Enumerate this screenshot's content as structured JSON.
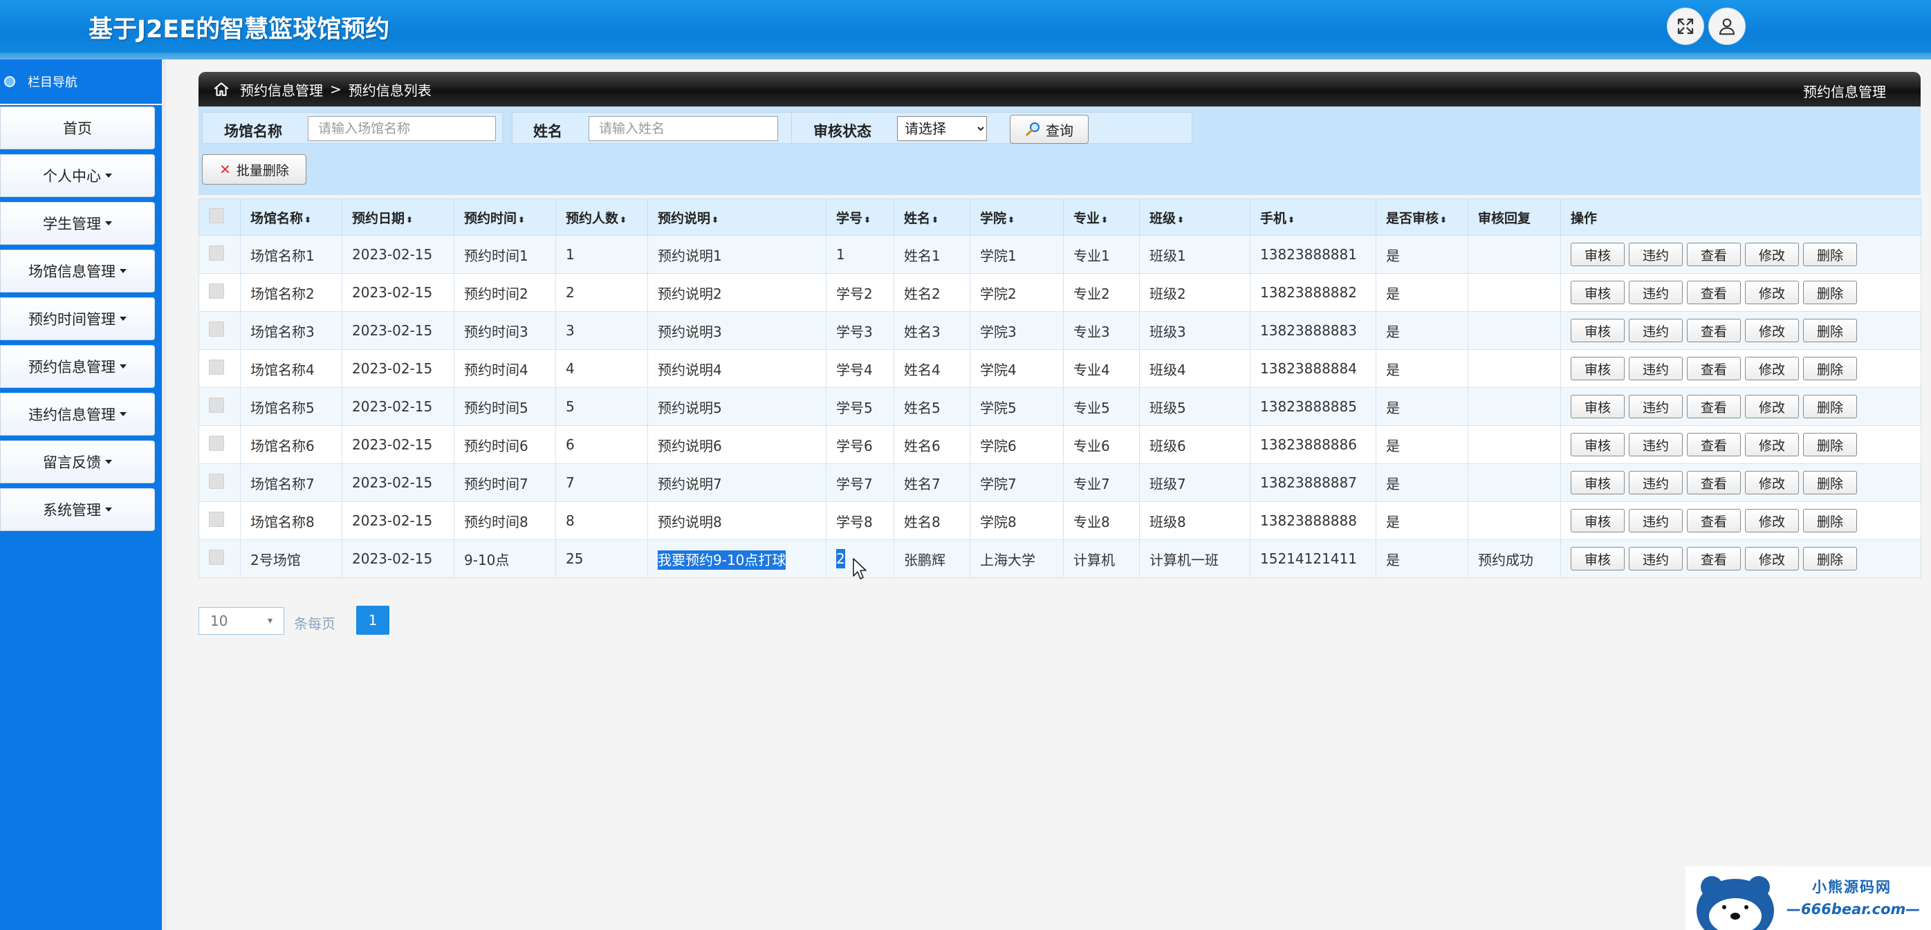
{
  "header": {
    "title": "基于J2EE的智慧篮球馆预约"
  },
  "sidebar": {
    "nav_title": "栏目导航",
    "items": [
      {
        "label": "首页",
        "has_caret": false
      },
      {
        "label": "个人中心",
        "has_caret": true
      },
      {
        "label": "学生管理",
        "has_caret": true
      },
      {
        "label": "场馆信息管理",
        "has_caret": true
      },
      {
        "label": "预约时间管理",
        "has_caret": true
      },
      {
        "label": "预约信息管理",
        "has_caret": true
      },
      {
        "label": "违约信息管理",
        "has_caret": true
      },
      {
        "label": "留言反馈",
        "has_caret": true
      },
      {
        "label": "系统管理",
        "has_caret": true
      }
    ]
  },
  "breadcrumb": {
    "level1": "预约信息管理",
    "separator": ">",
    "level2": "预约信息列表",
    "right_title": "预约信息管理"
  },
  "search": {
    "venue_label": "场馆名称",
    "venue_placeholder": "请输入场馆名称",
    "name_label": "姓名",
    "name_placeholder": "请输入姓名",
    "status_label": "审核状态",
    "status_selected": "请选择",
    "query_button": "查询",
    "batch_delete_button": "批量删除"
  },
  "table": {
    "columns": [
      "场馆名称",
      "预约日期",
      "预约时间",
      "预约人数",
      "预约说明",
      "学号",
      "姓名",
      "学院",
      "专业",
      "班级",
      "手机",
      "是否审核",
      "审核回复",
      "操作"
    ],
    "sortable": [
      true,
      true,
      true,
      true,
      true,
      true,
      true,
      true,
      true,
      true,
      true,
      true,
      false,
      false
    ],
    "actions": [
      "审核",
      "违约",
      "查看",
      "修改",
      "删除"
    ],
    "rows": [
      [
        "场馆名称1",
        "2023-02-15",
        "预约时间1",
        "1",
        "预约说明1",
        "1",
        "姓名1",
        "学院1",
        "专业1",
        "班级1",
        "13823888881",
        "是",
        ""
      ],
      [
        "场馆名称2",
        "2023-02-15",
        "预约时间2",
        "2",
        "预约说明2",
        "学号2",
        "姓名2",
        "学院2",
        "专业2",
        "班级2",
        "13823888882",
        "是",
        ""
      ],
      [
        "场馆名称3",
        "2023-02-15",
        "预约时间3",
        "3",
        "预约说明3",
        "学号3",
        "姓名3",
        "学院3",
        "专业3",
        "班级3",
        "13823888883",
        "是",
        ""
      ],
      [
        "场馆名称4",
        "2023-02-15",
        "预约时间4",
        "4",
        "预约说明4",
        "学号4",
        "姓名4",
        "学院4",
        "专业4",
        "班级4",
        "13823888884",
        "是",
        ""
      ],
      [
        "场馆名称5",
        "2023-02-15",
        "预约时间5",
        "5",
        "预约说明5",
        "学号5",
        "姓名5",
        "学院5",
        "专业5",
        "班级5",
        "13823888885",
        "是",
        ""
      ],
      [
        "场馆名称6",
        "2023-02-15",
        "预约时间6",
        "6",
        "预约说明6",
        "学号6",
        "姓名6",
        "学院6",
        "专业6",
        "班级6",
        "13823888886",
        "是",
        ""
      ],
      [
        "场馆名称7",
        "2023-02-15",
        "预约时间7",
        "7",
        "预约说明7",
        "学号7",
        "姓名7",
        "学院7",
        "专业7",
        "班级7",
        "13823888887",
        "是",
        ""
      ],
      [
        "场馆名称8",
        "2023-02-15",
        "预约时间8",
        "8",
        "预约说明8",
        "学号8",
        "姓名8",
        "学院8",
        "专业8",
        "班级8",
        "13823888888",
        "是",
        ""
      ],
      [
        "2号场馆",
        "2023-02-15",
        "9-10点",
        "25",
        "我要预约9-10点打球",
        "2",
        "张鹏辉",
        "上海大学",
        "计算机",
        "计算机一班",
        "15214121411",
        "是",
        "预约成功"
      ]
    ],
    "highlighted_row_index": 8
  },
  "pager": {
    "page_size": "10",
    "per_page_label": "条每页",
    "current_page": "1"
  },
  "watermark": {
    "line1": "小熊源码网",
    "line2": "—666bear.com—"
  },
  "colors": {
    "header_blue": "#0b7fd9",
    "sidebar_blue": "#0b78e6",
    "search_panel": "#c5e3fb",
    "selection": "#1c78e0"
  }
}
